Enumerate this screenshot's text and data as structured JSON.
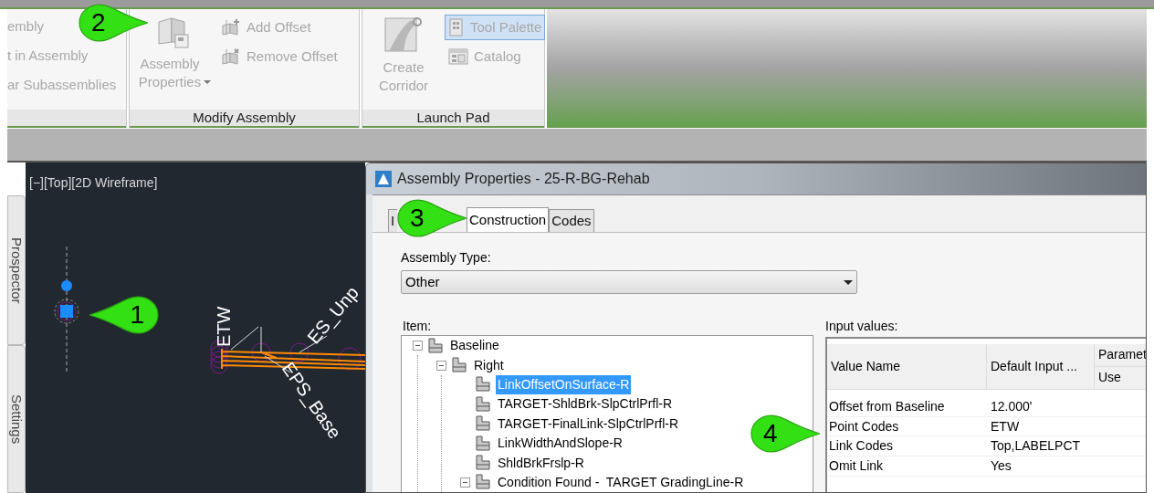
{
  "ribbon": {
    "left_panel": {
      "items": [
        {
          "label": "embly"
        },
        {
          "label": "t in Assembly"
        },
        {
          "label": "ar Subassemblies"
        }
      ]
    },
    "panels": [
      {
        "title": "Modify Assembly",
        "large": {
          "label": "Assembly Properties",
          "disabled": true,
          "has_menu": true
        },
        "small": [
          {
            "label": "Add Offset",
            "disabled": true,
            "active": false
          },
          {
            "label": "Remove Offset",
            "disabled": true,
            "active": false
          }
        ]
      },
      {
        "title": "Launch Pad",
        "large": {
          "label": "Create Corridor",
          "disabled": true,
          "has_menu": false
        },
        "small": [
          {
            "label": "Tool Palette",
            "disabled": true,
            "active": true
          },
          {
            "label": "Catalog",
            "disabled": true,
            "active": false
          }
        ]
      }
    ]
  },
  "side_tabs": [
    {
      "label": "Prospector"
    },
    {
      "label": "Settings"
    }
  ],
  "viewport": {
    "label": "[−][Top][2D Wireframe]",
    "drawing_labels": [
      {
        "label": "ETW"
      },
      {
        "label": "ES_Unp"
      },
      {
        "label": "EPS_Base"
      }
    ]
  },
  "dialog": {
    "title": "Assembly Properties - 25-R-BG-Rehab",
    "tabs": [
      {
        "label": "I",
        "selected": false
      },
      {
        "label": "Construction",
        "selected": true
      },
      {
        "label": "Codes",
        "selected": false
      }
    ],
    "assembly_type": {
      "label": "Assembly Type:",
      "value": "Other"
    },
    "item_label": "Item:",
    "tree": [
      {
        "label": "Baseline",
        "expanded": true,
        "selected": false,
        "children": [
          {
            "label": "Right",
            "expanded": true,
            "selected": false,
            "children": [
              {
                "label": "LinkOffsetOnSurface-R",
                "selected": true
              },
              {
                "label": "TARGET-ShldBrk-SlpCtrlPrfl-R",
                "selected": false
              },
              {
                "label": "TARGET-FinalLink-SlpCtrlPrfl-R",
                "selected": false
              },
              {
                "label": "LinkWidthAndSlope-R",
                "selected": false
              },
              {
                "label": "ShldBrkFrslp-R",
                "selected": false
              },
              {
                "label": "Condition Found -  TARGET GradingLine-R",
                "expanded": true,
                "selected": false
              }
            ]
          }
        ]
      }
    ],
    "input_values": {
      "label": "Input values:",
      "columns": [
        "Value Name",
        "Default Input ..."
      ],
      "group_column": {
        "label": "Paramet",
        "sub": "Use"
      },
      "rows": [
        {
          "name": "Offset from Baseline",
          "default": "12.000'"
        },
        {
          "name": "Point Codes",
          "default": "ETW"
        },
        {
          "name": "Link Codes",
          "default": "Top,LABELPCT"
        },
        {
          "name": "Omit Link",
          "default": "Yes"
        }
      ]
    }
  },
  "callouts": [
    {
      "label": "1"
    },
    {
      "label": "2"
    },
    {
      "label": "3"
    },
    {
      "label": "4"
    }
  ]
}
